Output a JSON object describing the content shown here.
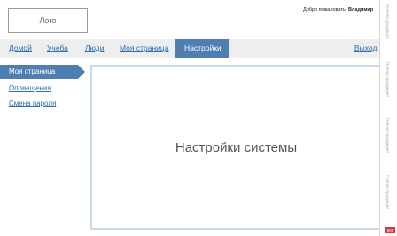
{
  "header": {
    "logo_text": "Лого",
    "welcome_prefix": "Добро пожаловать,",
    "user_name": "Владимир"
  },
  "nav": {
    "items": [
      {
        "label": "Домой"
      },
      {
        "label": "Учеба"
      },
      {
        "label": "Люди"
      },
      {
        "label": "Моя страница"
      },
      {
        "label": "Настройки"
      }
    ],
    "logout_label": "Выход",
    "active_color": "#4f7eb3"
  },
  "sidebar": {
    "items": [
      {
        "label": "Моя страница"
      },
      {
        "label": "Оповещения"
      },
      {
        "label": "Смена пароля"
      }
    ]
  },
  "main": {
    "title": "Настройки системы"
  },
  "side_strip": {
    "labels": [
      "Полная продукция",
      "Полная продукция",
      "Полная продукция",
      "Полная продукция"
    ],
    "badge": "606"
  }
}
